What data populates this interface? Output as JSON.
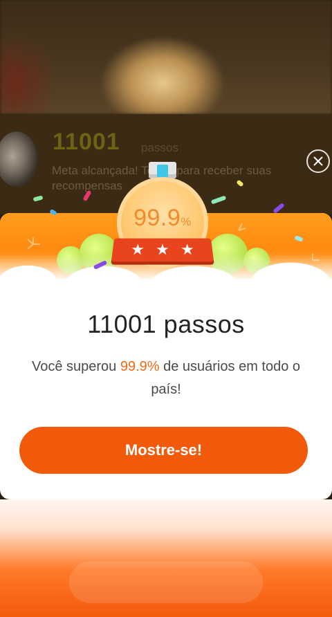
{
  "background": {
    "steps_value": "11001",
    "steps_unit": "passos",
    "note": "Meta alcançada! Toque para receber suas recompensas"
  },
  "medal": {
    "value": "99.9",
    "unit": "%",
    "stars": [
      "★",
      "★",
      "★"
    ]
  },
  "card": {
    "title": "11001 passos",
    "desc_before": "Você superou ",
    "desc_percent": "99.9%",
    "desc_after": " de usuários em todo o país!",
    "button_label": "Mostre-se!"
  },
  "colors": {
    "accent": "#f05a0a",
    "percent_text": "#f06a14",
    "banner": "#ff9c1d"
  },
  "icons": {
    "close": "close-icon",
    "star": "star-icon"
  }
}
